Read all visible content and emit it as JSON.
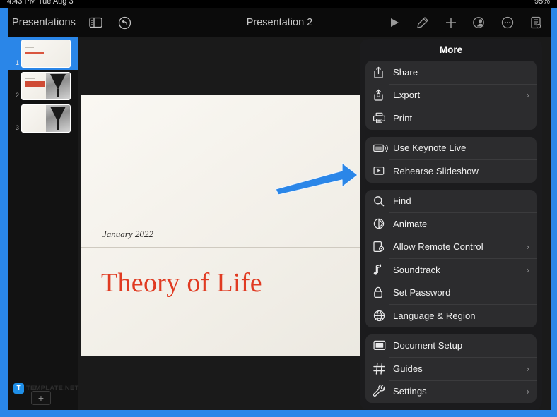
{
  "status_bar": {
    "left": "4:43 PM  Tue Aug 3",
    "right": "95%"
  },
  "toolbar": {
    "back_label": "Presentations",
    "title": "Presentation 2",
    "left_icons": [
      {
        "name": "view-options-icon",
        "label": "View Options"
      },
      {
        "name": "undo-icon",
        "label": "Undo"
      }
    ],
    "right_icons": [
      {
        "name": "play-icon",
        "label": "Play"
      },
      {
        "name": "markup-pen-icon",
        "label": "Markup"
      },
      {
        "name": "add-icon",
        "label": "Insert"
      },
      {
        "name": "collaborate-icon",
        "label": "Collaborate"
      },
      {
        "name": "more-icon",
        "label": "More"
      },
      {
        "name": "document-icon",
        "label": "Document Options"
      }
    ]
  },
  "navigator": {
    "slides": [
      {
        "number": "1",
        "selected": true,
        "has_image": false,
        "has_red_bar": false
      },
      {
        "number": "2",
        "selected": false,
        "has_image": true,
        "has_red_bar": true
      },
      {
        "number": "3",
        "selected": false,
        "has_image": true,
        "has_red_bar": false
      }
    ],
    "add_slide_label": "+",
    "watermark": {
      "logo": "T",
      "text": "TEMPLATE.NET"
    }
  },
  "slide": {
    "date": "January 2022",
    "title": "Theory of Life"
  },
  "annotation": {
    "arrow_color": "#2a86e8",
    "points_to": "more-menu"
  },
  "highlight_frame": {
    "color": "#2a86e8"
  },
  "more_menu": {
    "title": "More",
    "groups": [
      {
        "items": [
          {
            "label": "Share",
            "icon": "share-icon",
            "chevron": false
          },
          {
            "label": "Export",
            "icon": "export-icon",
            "chevron": true
          },
          {
            "label": "Print",
            "icon": "print-icon",
            "chevron": false
          }
        ]
      },
      {
        "items": [
          {
            "label": "Use Keynote Live",
            "icon": "keynote-live-icon",
            "chevron": false
          },
          {
            "label": "Rehearse Slideshow",
            "icon": "rehearse-icon",
            "chevron": false
          }
        ]
      },
      {
        "items": [
          {
            "label": "Find",
            "icon": "search-icon",
            "chevron": false
          },
          {
            "label": "Animate",
            "icon": "animate-icon",
            "chevron": false
          },
          {
            "label": "Allow Remote Control",
            "icon": "remote-control-icon",
            "chevron": true
          },
          {
            "label": "Soundtrack",
            "icon": "music-note-icon",
            "chevron": true
          },
          {
            "label": "Set Password",
            "icon": "lock-icon",
            "chevron": false
          },
          {
            "label": "Language & Region",
            "icon": "globe-icon",
            "chevron": false
          }
        ]
      },
      {
        "items": [
          {
            "label": "Document Setup",
            "icon": "document-setup-icon",
            "chevron": false
          },
          {
            "label": "Guides",
            "icon": "guides-icon",
            "chevron": true
          },
          {
            "label": "Settings",
            "icon": "wrench-icon",
            "chevron": true
          }
        ]
      }
    ]
  }
}
